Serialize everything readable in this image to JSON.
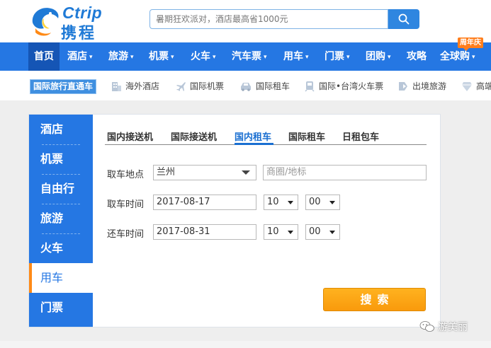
{
  "header": {
    "logo_en": "Ctrip",
    "logo_cn": "携程",
    "search_placeholder": "暑期狂欢派对，酒店最高省1000元"
  },
  "nav": {
    "items": [
      {
        "label": "首页",
        "caret": ""
      },
      {
        "label": "酒店",
        "caret": "▾"
      },
      {
        "label": "旅游",
        "caret": "▾"
      },
      {
        "label": "机票",
        "caret": "▾"
      },
      {
        "label": "火车",
        "caret": "▾"
      },
      {
        "label": "汽车票",
        "caret": "▾"
      },
      {
        "label": "用车",
        "caret": "▾"
      },
      {
        "label": "门票",
        "caret": "▾"
      },
      {
        "label": "团购",
        "caret": "▾"
      },
      {
        "label": "攻略",
        "caret": ""
      },
      {
        "label": "全球购",
        "caret": "▾"
      }
    ],
    "badge": "周年庆"
  },
  "subnav": {
    "tag": "国际旅行直通车",
    "items": [
      "海外酒店",
      "国际机票",
      "国际租车",
      "国际•台湾火车票",
      "出境旅游",
      "高端"
    ]
  },
  "sidebar": {
    "items": [
      "酒店",
      "机票",
      "自由行",
      "旅游",
      "火车",
      "用车",
      "门票"
    ]
  },
  "tabs": [
    "国内接送机",
    "国际接送机",
    "国内租车",
    "国际租车",
    "日租包车"
  ],
  "form": {
    "pickup_label": "取车地点",
    "pickup_city": "兰州",
    "pickup_area_placeholder": "商圈/地标",
    "pickup_time_label": "取车时间",
    "pickup_date": "2017-08-17",
    "pickup_hour": "10",
    "pickup_minute": "00",
    "return_time_label": "还车时间",
    "return_date": "2017-08-31",
    "return_hour": "10",
    "return_minute": "00",
    "submit_label": "搜索"
  },
  "watermark": "游美丽",
  "colors": {
    "brand_blue": "#2577e3",
    "accent_orange": "#ff8a16"
  }
}
